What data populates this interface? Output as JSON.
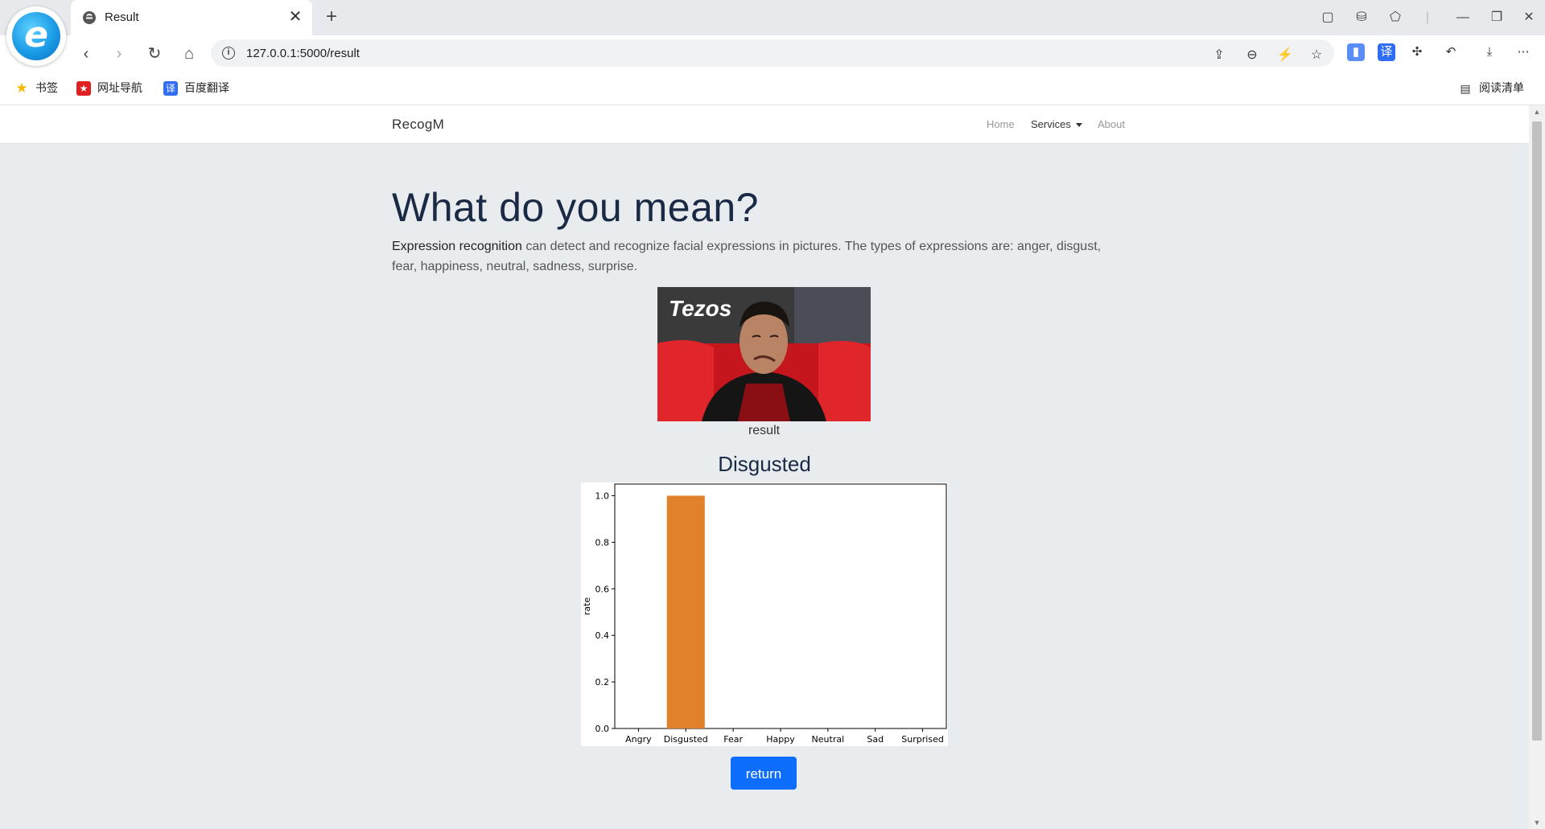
{
  "browser": {
    "tab_title": "Result",
    "url": "127.0.0.1:5000/result",
    "bookmarks": [
      {
        "label": "书签",
        "icon": "star-icon",
        "color": "#f5b800"
      },
      {
        "label": "网址导航",
        "icon": "nav-icon",
        "color": "#e02020"
      },
      {
        "label": "百度翻译",
        "icon": "translate-icon",
        "color": "#2f6df6"
      }
    ],
    "reading_list": "阅读清单"
  },
  "site": {
    "brand": "RecogM",
    "nav": [
      {
        "label": "Home",
        "active": false
      },
      {
        "label": "Services",
        "active": true,
        "dropdown": true
      },
      {
        "label": "About",
        "active": false
      }
    ]
  },
  "main": {
    "heading": "What do you mean?",
    "lead_strong": "Expression recognition",
    "lead_rest": " can detect and recognize facial expressions in pictures. The types of expressions are: anger, disgust, fear, happiness, neutral, sadness, surprise.",
    "image_caption": "result",
    "result_label": "Disgusted",
    "return_label": "return"
  },
  "colors": {
    "accent": "#0d6efd",
    "bar": "#e1812c",
    "page_bg": "#e9ecef"
  },
  "chart_data": {
    "type": "bar",
    "categories": [
      "Angry",
      "Disgusted",
      "Fear",
      "Happy",
      "Neutral",
      "Sad",
      "Surprised"
    ],
    "values": [
      0.0,
      1.0,
      0.0,
      0.0,
      0.0,
      0.0,
      0.0
    ],
    "ylabel": "rate",
    "ylim": [
      0,
      1.05
    ],
    "yticks": [
      "0.0",
      "0.2",
      "0.4",
      "0.6",
      "0.8",
      "1.0"
    ],
    "grid": false
  }
}
